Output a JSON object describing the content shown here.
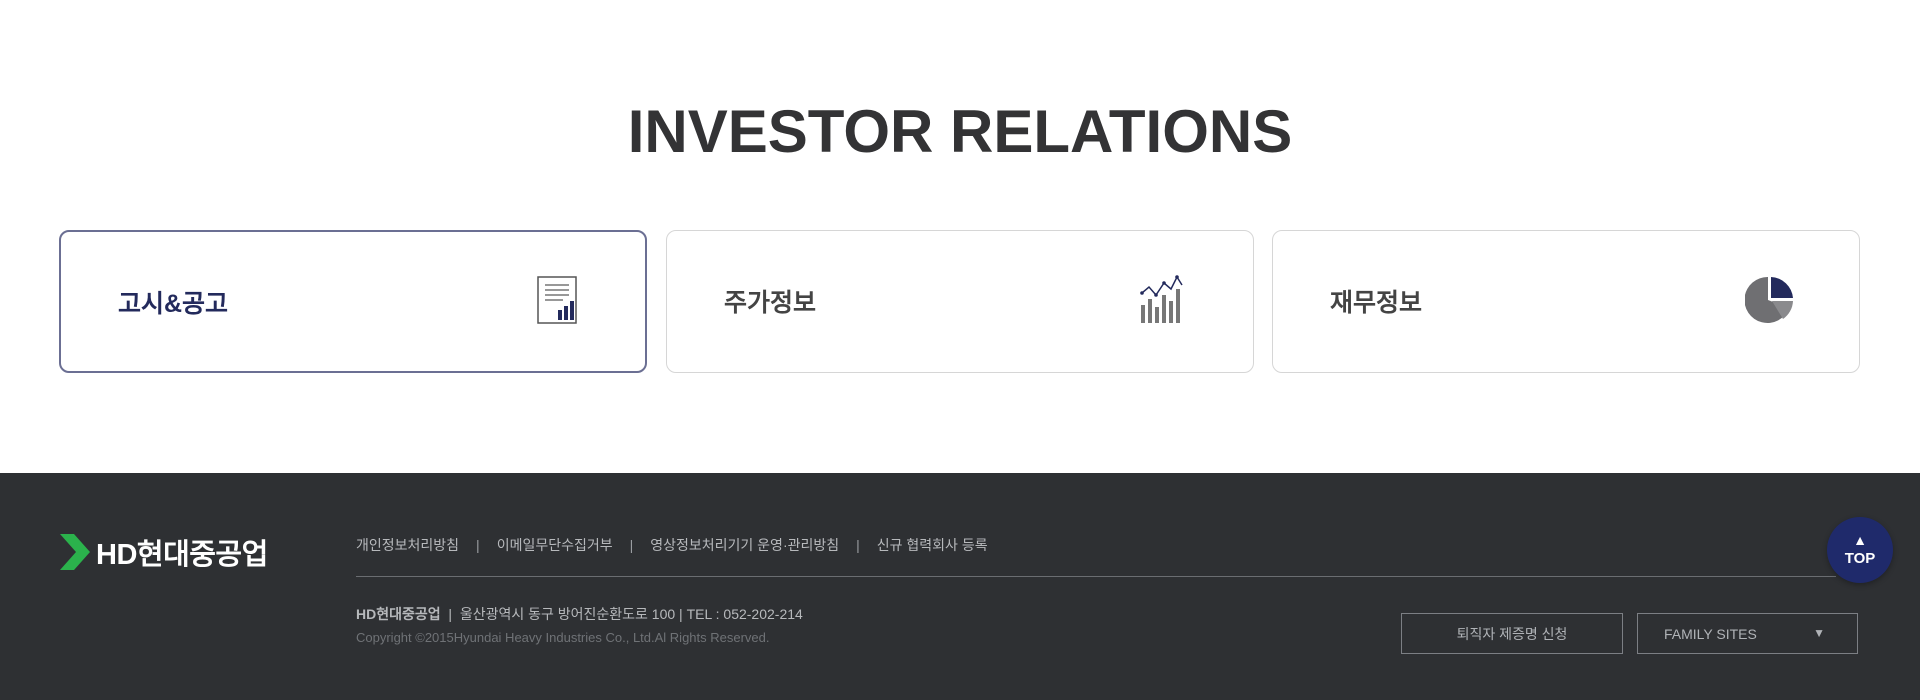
{
  "section": {
    "title": "INVESTOR RELATIONS"
  },
  "cards": [
    {
      "label": "고시&공고",
      "icon": "document-chart-icon"
    },
    {
      "label": "주가정보",
      "icon": "stock-chart-icon"
    },
    {
      "label": "재무정보",
      "icon": "pie-chart-icon"
    }
  ],
  "footer": {
    "logo_text": "HD현대중공업",
    "links": [
      "개인정보처리방침",
      "이메일무단수집거부",
      "영상정보처리기기 운영·관리방침",
      "신규 협력회사 등록"
    ],
    "separator": "|",
    "company": "HD현대중공업",
    "address": "  |  울산광역시 동구 방어진순환도로 100 | TEL : 052-202-214",
    "copyright": "Copyright ©2015Hyundai Heavy Industries Co., Ltd.Al Rights Reserved.",
    "cert_button": "퇴직자 제증명 신청",
    "family_sites": "FAMILY SITES",
    "family_arrow": "▼"
  },
  "top_button": {
    "label": "TOP",
    "arrow": "▲"
  },
  "colors": {
    "brand_navy": "#1f2a6b",
    "footer_bg": "#2e3033",
    "logo_green": "#2bb24c"
  }
}
